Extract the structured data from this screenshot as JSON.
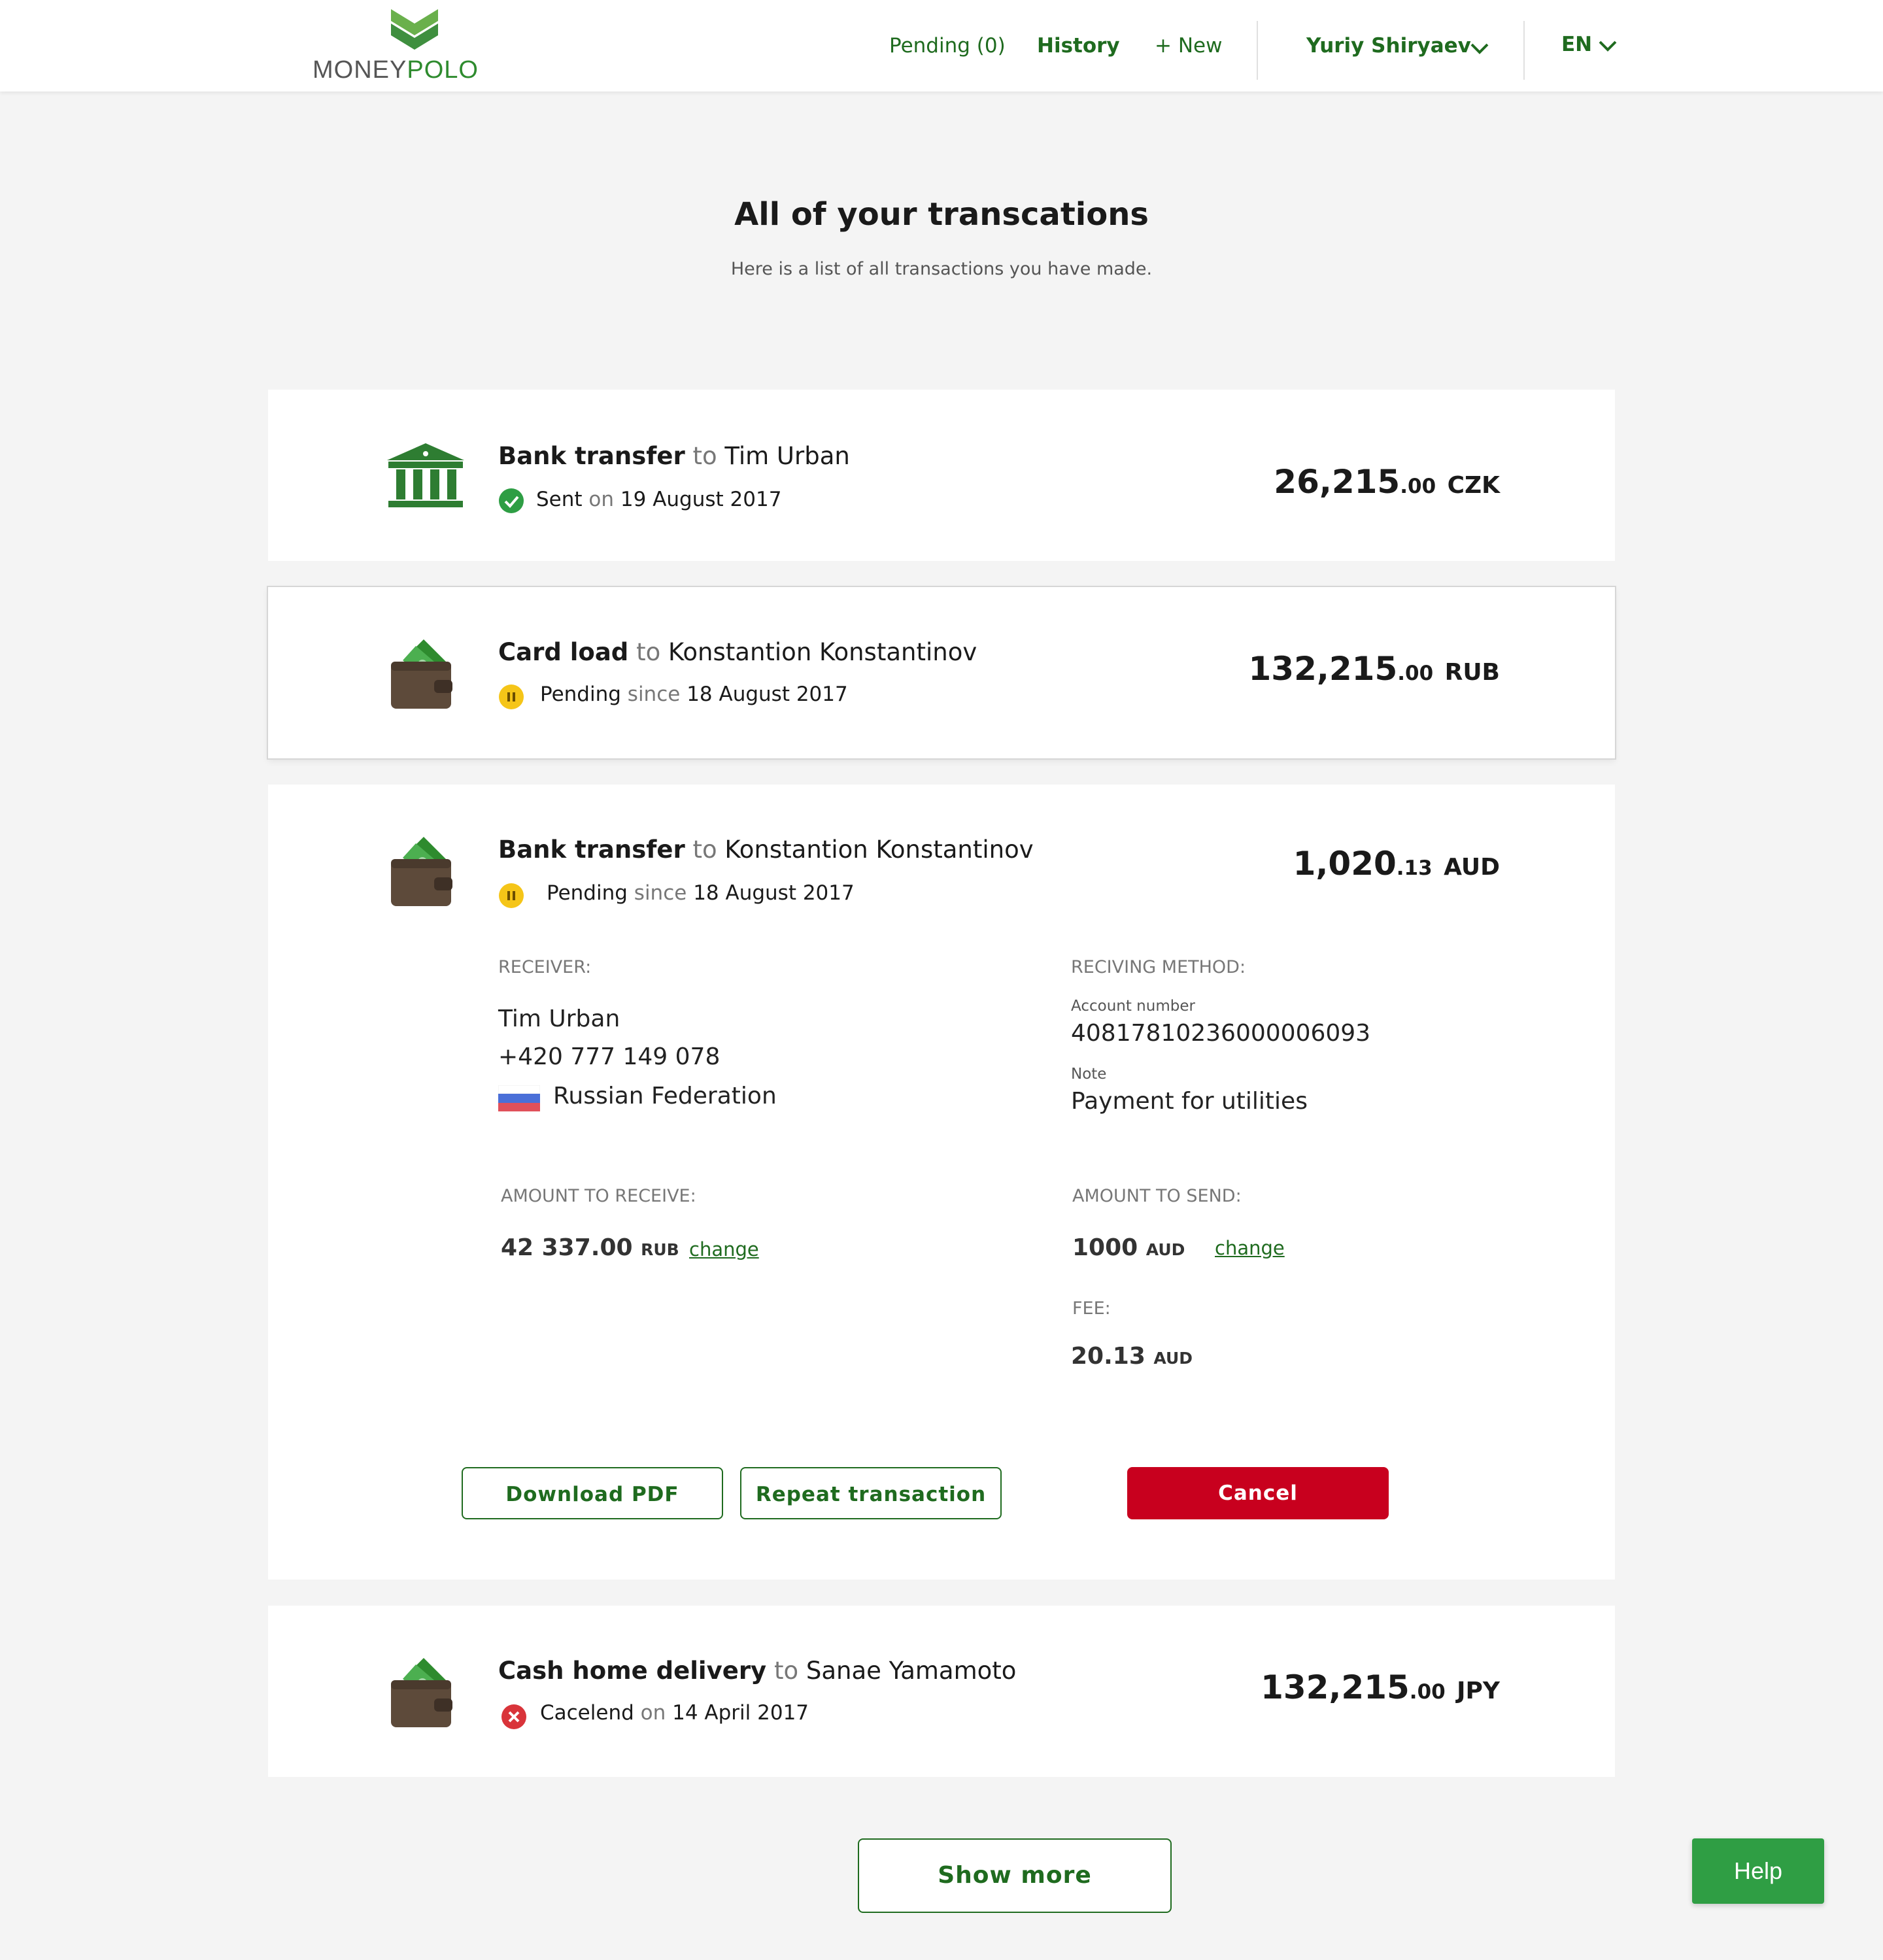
{
  "header": {
    "logo_money": "MONEY",
    "logo_polo": "POLO",
    "nav": {
      "pending": "Pending (0)",
      "history": "History",
      "new": "+ New"
    },
    "user_name": "Yuriy Shiryaev",
    "language": "EN"
  },
  "page": {
    "title": "All of your transcations",
    "subtitle": "Here is a list of all transactions you have made."
  },
  "transactions": [
    {
      "type": "Bank transfer",
      "to_word": "to",
      "recipient": "Tim Urban",
      "status": "Sent",
      "date_word": "on",
      "date": "19 August 2017",
      "amount_main": "26,215",
      "amount_cents": ".00",
      "currency": "CZK",
      "icon": "bank-icon",
      "status_icon": "check-circle-icon"
    },
    {
      "type": "Card load",
      "to_word": "to",
      "recipient": "Konstantion Konstantinov",
      "status": "Pending",
      "date_word": "since",
      "date": "18 August 2017",
      "amount_main": "132,215",
      "amount_cents": ".00",
      "currency": "RUB",
      "icon": "wallet-icon",
      "status_icon": "pause-circle-icon"
    },
    {
      "type": "Bank transfer",
      "to_word": "to",
      "recipient": "Konstantion Konstantinov",
      "status": "Pending",
      "date_word": "since",
      "date": "18 August 2017",
      "amount_main": "1,020",
      "amount_cents": ".13",
      "currency": "AUD",
      "icon": "wallet-icon",
      "status_icon": "pause-circle-icon",
      "details": {
        "receiver_label": "RECEIVER:",
        "receiver_name": "Tim Urban",
        "receiver_phone": "+420 777 149 078",
        "receiver_country": "Russian Federation",
        "method_label": "RECIVING METHOD:",
        "account_label": "Account number",
        "account_number": "40817810236000006093",
        "note_label": "Note",
        "note": "Payment for utilities",
        "amount_receive_label": "AMOUNT TO RECEIVE:",
        "amount_receive_main": "42 337",
        "amount_receive_cents": ".00",
        "amount_receive_unit": "RUB",
        "amount_send_label": "AMOUNT TO SEND:",
        "amount_send_main": "1000",
        "amount_send_unit": "AUD",
        "fee_label": "FEE:",
        "fee_main": "20.13",
        "fee_unit": "AUD",
        "change_label": "change",
        "download_pdf": "Download PDF",
        "repeat_transaction": "Repeat transaction",
        "cancel": "Cancel"
      }
    },
    {
      "type": "Cash home delivery",
      "to_word": "to",
      "recipient": "Sanae Yamamoto",
      "status": "Cacelend",
      "date_word": "on",
      "date": "14 April 2017",
      "amount_main": "132,215",
      "amount_cents": ".00",
      "currency": "JPY",
      "icon": "wallet-icon",
      "status_icon": "cancel-circle-icon"
    }
  ],
  "show_more": "Show more",
  "help": "Help",
  "colors": {
    "brand_green": "#1f6b1f",
    "accent_green": "#2e8b2e",
    "cancel_red": "#c8001e",
    "pending_yellow": "#f5c518",
    "help_green": "#2f9e44"
  }
}
